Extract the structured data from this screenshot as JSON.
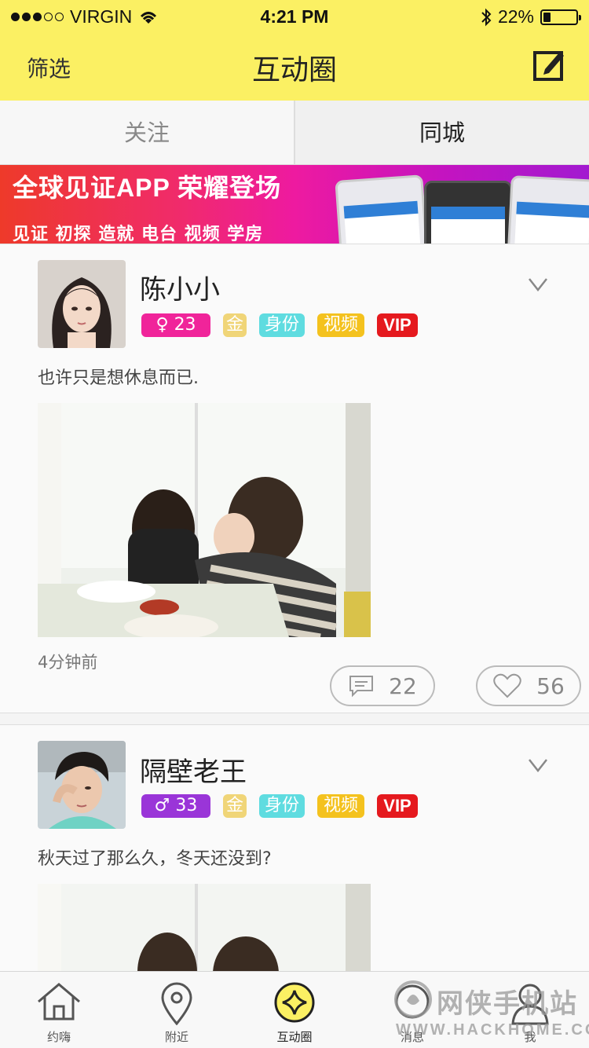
{
  "status_bar": {
    "carrier": "VIRGIN",
    "time": "4:21 PM",
    "battery": "22%",
    "battery_level": 0.22
  },
  "nav": {
    "left_label": "筛选",
    "title": "互动圈",
    "edit_icon": "compose-icon"
  },
  "tabs": [
    {
      "label": "关注",
      "active": false
    },
    {
      "label": "同城",
      "active": true
    }
  ],
  "banner": {
    "headline": "全球见证APP 荣耀登场",
    "tagline": "见证 初探 造就 电台 视频 学房"
  },
  "posts": [
    {
      "username": "陈小小",
      "gender": "female",
      "gender_symbol": "♀",
      "age": "23",
      "gender_color": "#f0249a",
      "badges": {
        "gold": "金",
        "identity": "身份",
        "video": "视频",
        "vip": "VIP"
      },
      "text": "也许只是想休息而已.",
      "time": "4分钟前",
      "comments": "22",
      "likes": "56"
    },
    {
      "username": "隔壁老王",
      "gender": "male",
      "gender_symbol": "♂",
      "age": "33",
      "gender_color": "#9a35d8",
      "badges": {
        "gold": "金",
        "identity": "身份",
        "video": "视频",
        "vip": "VIP"
      },
      "text": "秋天过了那么久，冬天还没到?"
    }
  ],
  "tabbar": [
    {
      "label": "约嗨",
      "icon": "home-icon"
    },
    {
      "label": "附近",
      "icon": "location-pin-icon"
    },
    {
      "label": "互动圈",
      "icon": "interaction-circle-icon",
      "active": true
    },
    {
      "label": "消息",
      "icon": "message-icon"
    },
    {
      "label": "我",
      "icon": "profile-icon"
    }
  ],
  "watermark": {
    "name": "网侠手机站",
    "url": "WWW.HACKHOME.COM"
  }
}
